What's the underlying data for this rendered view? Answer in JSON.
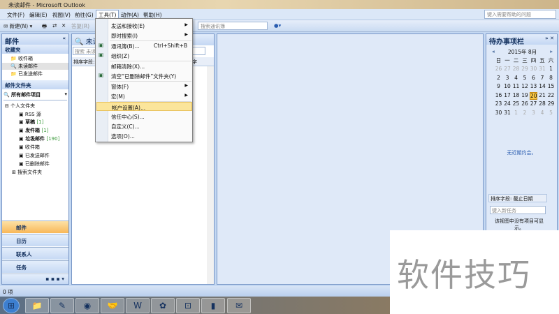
{
  "window": {
    "title": "未读邮件 - Microsoft Outlook"
  },
  "menubar": [
    "文件(F)",
    "编辑(E)",
    "视图(V)",
    "前往(G)",
    "工具(T)",
    "动作(A)",
    "帮助(H)"
  ],
  "help_placeholder": "键入需要帮助的问题",
  "toolbar": {
    "new": "新建(N)",
    "reply": "答复(R)",
    "address_search": "搜索通讯簿"
  },
  "tools_menu": [
    {
      "label": "发送和接收(E)",
      "submenu": true
    },
    {
      "label": "即时搜索(I)",
      "submenu": true
    },
    {
      "label": "通讯簿(B)...",
      "shortcut": "Ctrl+Shift+B",
      "icon": "address-book-icon"
    },
    {
      "label": "组织(Z)",
      "icon": "organize-icon"
    },
    {
      "label": "邮箱清除(X)..."
    },
    {
      "label": "清空“已删除邮件”文件夹(Y)",
      "icon": "empty-trash-icon"
    },
    {
      "label": "窗体(F)",
      "submenu": true
    },
    {
      "label": "宏(M)",
      "submenu": true
    },
    {
      "label": "帐户设置(A)...",
      "highlighted": true
    },
    {
      "label": "信任中心(S)..."
    },
    {
      "label": "自定义(C)..."
    },
    {
      "label": "选项(O)..."
    }
  ],
  "nav": {
    "title": "邮件",
    "favorites_title": "收藏夹",
    "favorites": [
      "收件箱",
      "未读邮件",
      "已发送邮件"
    ],
    "folders_title": "邮件文件夹",
    "all_items": "所有邮件项目",
    "root": "个人文件夹",
    "folders": [
      {
        "name": "RSS 源",
        "count": ""
      },
      {
        "name": "草稿",
        "count": "[1]"
      },
      {
        "name": "发件箱",
        "count": "[1]"
      },
      {
        "name": "垃圾邮件",
        "count": "[190]"
      },
      {
        "name": "收件箱",
        "count": ""
      },
      {
        "name": "已发送邮件",
        "count": ""
      },
      {
        "name": "已删除邮件",
        "count": ""
      },
      {
        "name": "搜索文件夹",
        "count": ""
      }
    ],
    "buttons": [
      "邮件",
      "日历",
      "联系人",
      "任务"
    ]
  },
  "list": {
    "title": "未读",
    "search": "搜索 未读",
    "sort": "排序字段:",
    "sort_right": "字"
  },
  "todo": {
    "title": "待办事项栏",
    "month": "2015年 8月",
    "weekdays": [
      "日",
      "一",
      "二",
      "三",
      "四",
      "五",
      "六"
    ],
    "days": [
      [
        "26",
        "27",
        "28",
        "29",
        "30",
        "31",
        "1"
      ],
      [
        "2",
        "3",
        "4",
        "5",
        "6",
        "7",
        "8"
      ],
      [
        "9",
        "10",
        "11",
        "12",
        "13",
        "14",
        "15"
      ],
      [
        "16",
        "17",
        "18",
        "19",
        "20",
        "21",
        "22"
      ],
      [
        "23",
        "24",
        "25",
        "26",
        "27",
        "28",
        "29"
      ],
      [
        "30",
        "31",
        "1",
        "2",
        "3",
        "4",
        "5"
      ]
    ],
    "today": "20",
    "no_appointments": "无近期约会。",
    "task_sort": "排序字段: 截止日期",
    "new_task_placeholder": "键入新任务",
    "empty_tasks": "该视图中没有项目可显示。"
  },
  "status": "0 项",
  "watermark": "软件技巧",
  "colors": {
    "accent": "#f8b859",
    "highlight": "#fbe59b",
    "frame": "#7896c6"
  }
}
